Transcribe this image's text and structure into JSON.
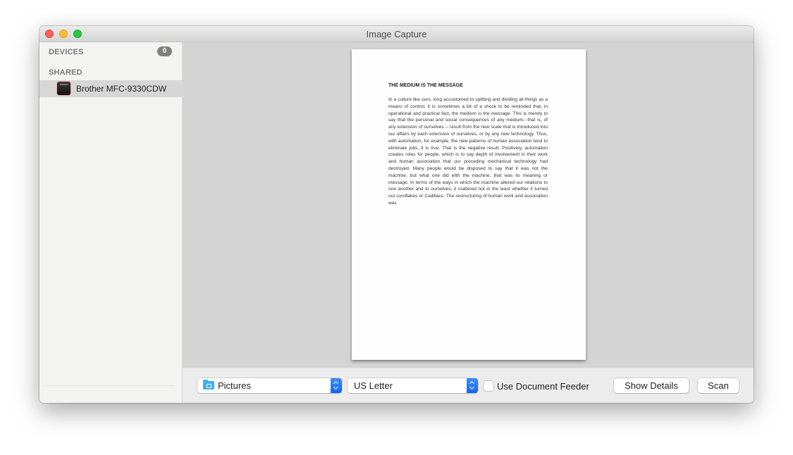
{
  "window": {
    "title": "Image Capture"
  },
  "sidebar": {
    "devices_header": "DEVICES",
    "devices_count": "0",
    "shared_header": "SHARED",
    "shared_items": [
      {
        "label": "Brother MFC-9330CDW",
        "icon": "printer-icon",
        "selected": true
      }
    ]
  },
  "preview": {
    "document_title": "THE MEDIUM IS THE MESSAGE",
    "document_body": "In a culture like ours, long accustomed to splitting and dividing all things as a means of control, it is sometimes a bit of a shock to be reminded that, in operational and practical fact, the medium is the message. This is merely to say that the personal and social consequences of any medium– that is, of any extension of ourselves -- result from the new scale that is introduced into our affairs by each extension of ourselves, or by any new technology. Thus, with automation, for example, the new patterns of human association tend to eliminate jobs, it is true. That is the negative result. Positively, automation creates roles for people, which is to say depth of involvement in their work and human association that our preceding mechanical technology had destroyed. Many people would be disposed to say that it was not the machine, but what one did with the machine, that was its meaning or message. In terms of the ways in which the machine altered our relations to one another and to ourselves, it mattered not in the least whether it turned out cornflakes or Cadillacs. The restructuring of human work and association was"
  },
  "toolbar": {
    "destination": {
      "value": "Pictures",
      "icon": "folder-pictures-icon"
    },
    "paper_size": {
      "value": "US Letter"
    },
    "document_feeder": {
      "label": "Use Document Feeder",
      "checked": false
    },
    "show_details_label": "Show Details",
    "scan_label": "Scan"
  }
}
